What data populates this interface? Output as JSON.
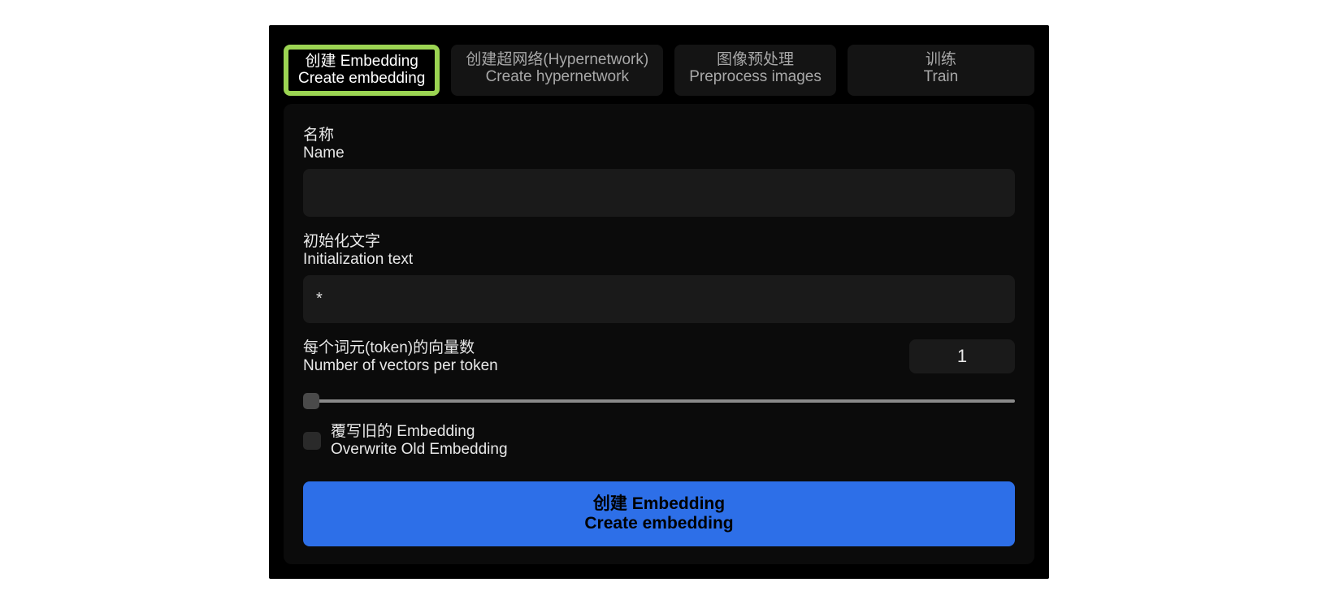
{
  "tabs": [
    {
      "zh": "创建 Embedding",
      "en": "Create embedding",
      "active": true
    },
    {
      "zh": "创建超网络(Hypernetwork)",
      "en": "Create hypernetwork",
      "active": false
    },
    {
      "zh": "图像预处理",
      "en": "Preprocess images",
      "active": false
    },
    {
      "zh": "训练",
      "en": "Train",
      "active": false
    }
  ],
  "form": {
    "name": {
      "label_zh": "名称",
      "label_en": "Name",
      "value": ""
    },
    "init_text": {
      "label_zh": "初始化文字",
      "label_en": "Initialization text",
      "value": "*"
    },
    "vectors_per_token": {
      "label_zh": "每个词元(token)的向量数",
      "label_en": "Number of vectors per token",
      "value": "1"
    },
    "overwrite": {
      "label_zh": "覆写旧的 Embedding",
      "label_en": "Overwrite Old Embedding",
      "checked": false
    }
  },
  "button": {
    "label_zh": "创建 Embedding",
    "label_en": "Create embedding"
  }
}
